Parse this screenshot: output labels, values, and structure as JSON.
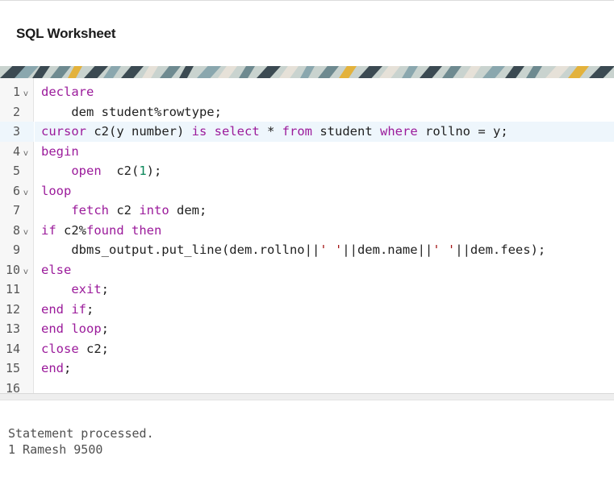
{
  "header": {
    "title": "SQL Worksheet"
  },
  "banner": {
    "colors": [
      "#3b4a52",
      "#8aa7ae",
      "#c9d3cf",
      "#e3b23c",
      "#6e8a90",
      "#e6e1d8"
    ]
  },
  "editor": {
    "active_line": 3,
    "lines": [
      {
        "n": "1",
        "fold": true,
        "tokens": [
          {
            "t": "kw",
            "v": "declare"
          }
        ]
      },
      {
        "n": "2",
        "fold": false,
        "tokens": [
          {
            "t": "",
            "v": "    dem student%rowtype;"
          }
        ]
      },
      {
        "n": "3",
        "fold": false,
        "tokens": [
          {
            "t": "kw",
            "v": "cursor"
          },
          {
            "t": "",
            "v": " c2(y number) "
          },
          {
            "t": "kw",
            "v": "is"
          },
          {
            "t": "",
            "v": " "
          },
          {
            "t": "kw",
            "v": "select"
          },
          {
            "t": "",
            "v": " * "
          },
          {
            "t": "kw",
            "v": "from"
          },
          {
            "t": "",
            "v": " student "
          },
          {
            "t": "kw",
            "v": "where"
          },
          {
            "t": "",
            "v": " rollno = y;"
          }
        ]
      },
      {
        "n": "4",
        "fold": true,
        "tokens": [
          {
            "t": "kw",
            "v": "begin"
          }
        ]
      },
      {
        "n": "5",
        "fold": false,
        "tokens": [
          {
            "t": "",
            "v": "    "
          },
          {
            "t": "kw",
            "v": "open"
          },
          {
            "t": "",
            "v": "  c2("
          },
          {
            "t": "num-lit",
            "v": "1"
          },
          {
            "t": "",
            "v": ");"
          }
        ]
      },
      {
        "n": "6",
        "fold": true,
        "tokens": [
          {
            "t": "kw",
            "v": "loop"
          }
        ]
      },
      {
        "n": "7",
        "fold": false,
        "tokens": [
          {
            "t": "",
            "v": "    "
          },
          {
            "t": "kw",
            "v": "fetch"
          },
          {
            "t": "",
            "v": " c2 "
          },
          {
            "t": "kw",
            "v": "into"
          },
          {
            "t": "",
            "v": " dem;"
          }
        ]
      },
      {
        "n": "8",
        "fold": true,
        "tokens": [
          {
            "t": "kw",
            "v": "if"
          },
          {
            "t": "",
            "v": " c2%"
          },
          {
            "t": "kw",
            "v": "found"
          },
          {
            "t": "",
            "v": " "
          },
          {
            "t": "kw",
            "v": "then"
          }
        ]
      },
      {
        "n": "9",
        "fold": false,
        "tokens": [
          {
            "t": "",
            "v": "    dbms_output.put_line(dem.rollno||"
          },
          {
            "t": "str",
            "v": "' '"
          },
          {
            "t": "",
            "v": "||dem.name||"
          },
          {
            "t": "str",
            "v": "' '"
          },
          {
            "t": "",
            "v": "||dem.fees);"
          }
        ]
      },
      {
        "n": "10",
        "fold": true,
        "tokens": [
          {
            "t": "kw",
            "v": "else"
          }
        ]
      },
      {
        "n": "11",
        "fold": false,
        "tokens": [
          {
            "t": "",
            "v": "    "
          },
          {
            "t": "kw",
            "v": "exit"
          },
          {
            "t": "",
            "v": ";"
          }
        ]
      },
      {
        "n": "12",
        "fold": false,
        "tokens": [
          {
            "t": "kw",
            "v": "end if"
          },
          {
            "t": "",
            "v": ";"
          }
        ]
      },
      {
        "n": "13",
        "fold": false,
        "tokens": [
          {
            "t": "kw",
            "v": "end loop"
          },
          {
            "t": "",
            "v": ";"
          }
        ]
      },
      {
        "n": "14",
        "fold": false,
        "tokens": [
          {
            "t": "kw",
            "v": "close"
          },
          {
            "t": "",
            "v": " c2;"
          }
        ]
      },
      {
        "n": "15",
        "fold": false,
        "tokens": [
          {
            "t": "kw",
            "v": "end"
          },
          {
            "t": "",
            "v": ";"
          }
        ]
      },
      {
        "n": "16",
        "fold": false,
        "tokens": []
      }
    ]
  },
  "output": {
    "lines": [
      "Statement processed.",
      "1 Ramesh 9500"
    ]
  }
}
